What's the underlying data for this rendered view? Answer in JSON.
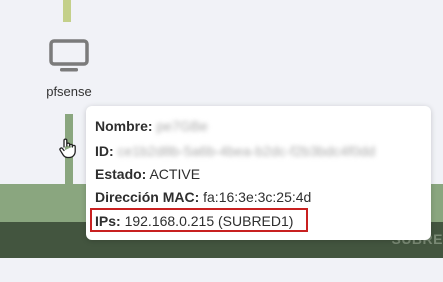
{
  "node": {
    "name": "pfsense",
    "icon": "monitor-icon"
  },
  "cursor": {
    "icon": "hand-pointer-icon"
  },
  "network": {
    "label": "SUBRE"
  },
  "tooltip": {
    "name_label": "Nombre:",
    "name_value": "pe7GBe",
    "id_label": "ID:",
    "id_value": "ce1b2d8b-5a6b-4bea-b2dc-f2b3bdc4f0dd",
    "status_label": "Estado:",
    "status_value": "ACTIVE",
    "mac_label": "Dirección MAC:",
    "mac_value": "fa:16:3e:3c:25:4d",
    "ips_label": "IPs:",
    "ips_value": "192.168.0.215 (SUBRED1)"
  },
  "colors": {
    "highlight": "#c82020",
    "network_band": "#8aa67f",
    "network_dark": "#43553f",
    "top_connector": "#c4d08a"
  }
}
